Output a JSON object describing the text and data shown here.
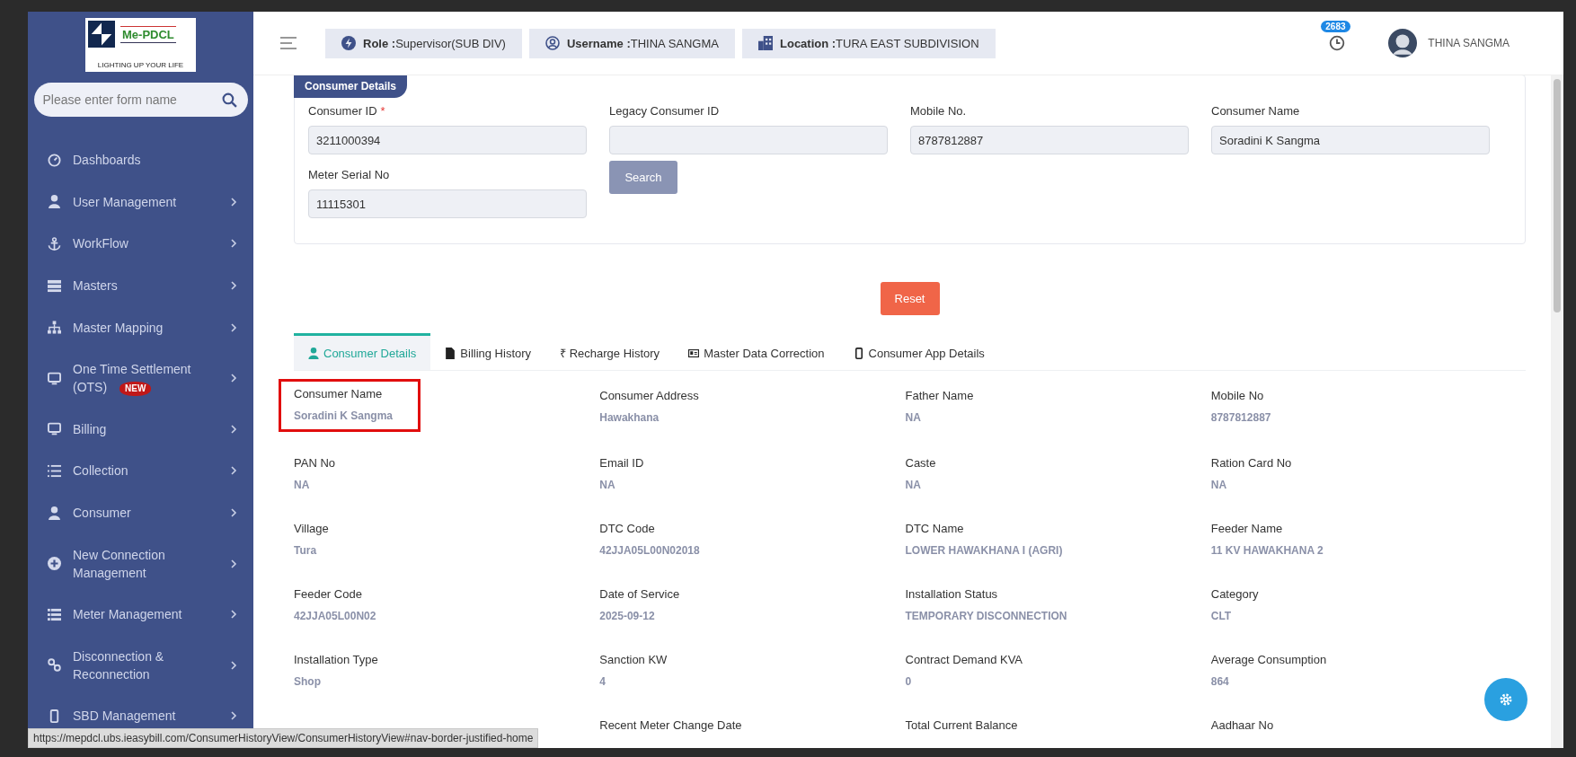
{
  "sidebar": {
    "logo": {
      "brand": "Me-PDCL",
      "tagline": "LIGHTING UP YOUR LIFE"
    },
    "search": {
      "placeholder": "Please enter form name"
    },
    "items": [
      {
        "label": "Dashboards",
        "kind": "gauge",
        "has_children": false
      },
      {
        "label": "User Management",
        "kind": "user",
        "has_children": true
      },
      {
        "label": "WorkFlow",
        "kind": "anchor",
        "has_children": true
      },
      {
        "label": "Masters",
        "kind": "server",
        "has_children": true
      },
      {
        "label": "Master Mapping",
        "kind": "sitemap",
        "has_children": true
      },
      {
        "label": "One Time Settlement (OTS)",
        "kind": "monitor",
        "has_children": true,
        "badge": "NEW"
      },
      {
        "label": "Billing",
        "kind": "monitor",
        "has_children": true
      },
      {
        "label": "Collection",
        "kind": "list-ol",
        "has_children": true
      },
      {
        "label": "Consumer",
        "kind": "user",
        "has_children": true
      },
      {
        "label": "New Connection Management",
        "kind": "plus-circle",
        "has_children": true
      },
      {
        "label": "Meter Management",
        "kind": "list",
        "has_children": true
      },
      {
        "label": "Disconnection & Reconnection",
        "kind": "link",
        "has_children": true
      },
      {
        "label": "SBD Management",
        "kind": "mobile",
        "has_children": true
      }
    ]
  },
  "header": {
    "chips": [
      {
        "kind": "bolt",
        "key": "Role :",
        "value": "Supervisor(SUB DIV)"
      },
      {
        "kind": "user-circle",
        "key": "Username :",
        "value": "THINA SANGMA"
      },
      {
        "kind": "building",
        "key": "Location :",
        "value": "TURA EAST SUBDIVISION"
      }
    ],
    "notification_count": "2683",
    "user_name": "THINA SANGMA"
  },
  "search_form": {
    "title": "Consumer Details",
    "fields": [
      {
        "label": "Consumer ID",
        "required_mark": "*",
        "value": "3211000394"
      },
      {
        "label": "Legacy Consumer ID"
      },
      {
        "label": "Mobile No.",
        "value": "8787812887"
      },
      {
        "label": "Consumer Name",
        "value": "Soradini K Sangma"
      },
      {
        "label": "Meter Serial No",
        "value": "11115301"
      }
    ],
    "search_button": "Search",
    "reset_button": "Reset"
  },
  "tabs": [
    {
      "label": "Consumer Details",
      "kind": "user",
      "selected": true
    },
    {
      "label": "Billing History",
      "kind": "file",
      "selected": false
    },
    {
      "label": "₹ Recharge History",
      "kind": "text",
      "selected": false
    },
    {
      "label": "Master Data Correction",
      "kind": "id-card",
      "selected": false
    },
    {
      "label": "Consumer App Details",
      "kind": "mobile",
      "selected": false
    }
  ],
  "details": [
    [
      {
        "label": "Consumer Name",
        "value": "Soradini K Sangma",
        "highlighted": true
      },
      {
        "label": "Consumer Address",
        "value": "Hawakhana"
      },
      {
        "label": "Father Name",
        "value": "NA"
      },
      {
        "label": "Mobile No",
        "value": "8787812887"
      }
    ],
    [
      {
        "label": "PAN No",
        "value": "NA"
      },
      {
        "label": "Email ID",
        "value": "NA"
      },
      {
        "label": "Caste",
        "value": "NA"
      },
      {
        "label": "Ration Card No",
        "value": "NA"
      }
    ],
    [
      {
        "label": "Village",
        "value": "Tura"
      },
      {
        "label": "DTC Code",
        "value": "42JJA05L00N02018"
      },
      {
        "label": "DTC Name",
        "value": "LOWER HAWAKHANA I (AGRI)"
      },
      {
        "label": "Feeder Name",
        "value": "11 KV HAWAKHANA 2"
      }
    ],
    [
      {
        "label": "Feeder Code",
        "value": "42JJA05L00N02"
      },
      {
        "label": "Date of Service",
        "value": "2025-09-12"
      },
      {
        "label": "Installation Status",
        "value": "TEMPORARY DISCONNECTION"
      },
      {
        "label": "Category",
        "value": "CLT"
      }
    ],
    [
      {
        "label": "Installation Type",
        "value": "Shop"
      },
      {
        "label": "Sanction KW",
        "value": "4"
      },
      {
        "label": "Contract Demand KVA",
        "value": "0"
      },
      {
        "label": "Average Consumption",
        "value": "864"
      }
    ],
    [
      {
        "label": "Recent Meter Change Date"
      },
      {
        "label": "Total Current Balance"
      },
      {
        "label": "Aadhaar No"
      }
    ]
  ],
  "status_url": "https://mepdcl.ubs.ieasybill.com/ConsumerHistoryView/ConsumerHistoryView#nav-border-justified-home"
}
